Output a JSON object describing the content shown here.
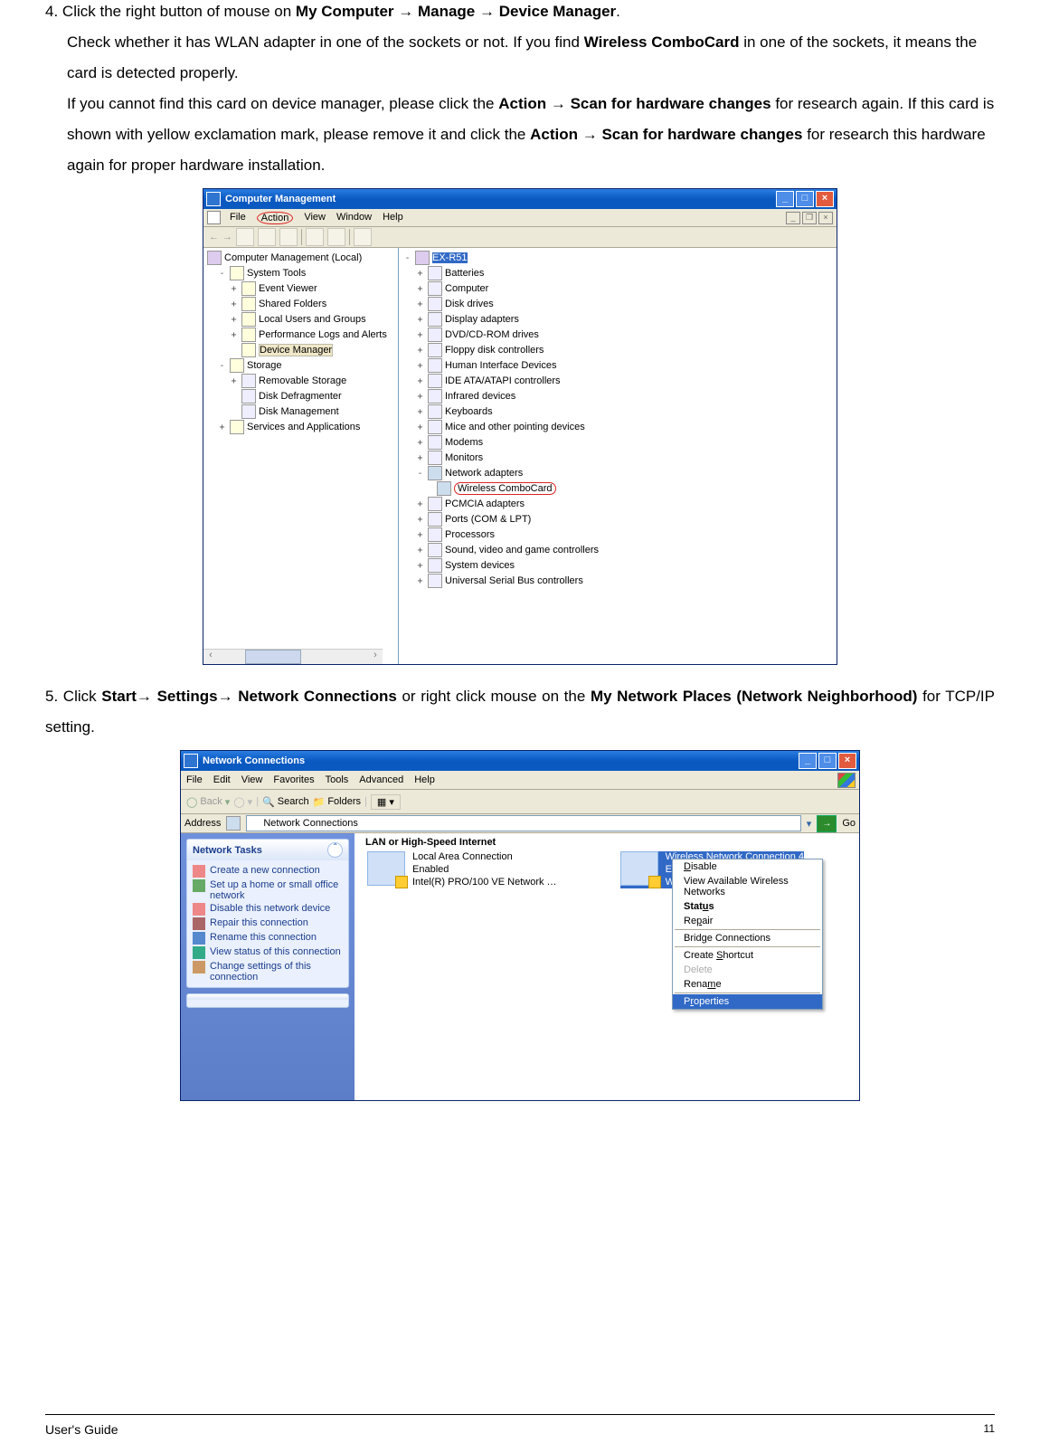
{
  "step4": {
    "num": "4.",
    "l1a": "Click the right button of mouse on ",
    "l1b": "My Computer → Manage → Device Manager",
    "l1c": ".",
    "l2a": "Check whether it has WLAN adapter in one of the sockets or not.  If you find ",
    "l2b": "Wireless ComboCard",
    "l2c": " in one of the sockets, it means the card is detected properly.",
    "l3a": "If you cannot find this card on device manager, please click the ",
    "l3b": "Action → Scan for hardware changes",
    "l3c": " for research again. If this card is shown with yellow exclamation mark, please remove it and click the ",
    "l3d": "Action → Scan for hardware changes",
    "l3e": " for research this hardware again for proper hardware installation."
  },
  "cm": {
    "title": "Computer Management",
    "menu": {
      "file": "File",
      "action": "Action",
      "view": "View",
      "window": "Window",
      "help": "Help"
    },
    "left": {
      "root": "Computer Management (Local)",
      "sys": "System Tools",
      "sys_items": [
        "Event Viewer",
        "Shared Folders",
        "Local Users and Groups",
        "Performance Logs and Alerts",
        "Device Manager"
      ],
      "storage": "Storage",
      "storage_items": [
        "Removable Storage",
        "Disk Defragmenter",
        "Disk Management"
      ],
      "svc": "Services and Applications"
    },
    "right": {
      "root": "EX-R51",
      "items": [
        "Batteries",
        "Computer",
        "Disk drives",
        "Display adapters",
        "DVD/CD-ROM drives",
        "Floppy disk controllers",
        "Human Interface Devices",
        "IDE ATA/ATAPI controllers",
        "Infrared devices",
        "Keyboards",
        "Mice and other pointing devices",
        "Modems",
        "Monitors"
      ],
      "net": "Network adapters",
      "net_child": "Wireless  ComboCard",
      "items2": [
        "PCMCIA adapters",
        "Ports (COM & LPT)",
        "Processors",
        "Sound, video and game controllers",
        "System devices",
        "Universal Serial Bus controllers"
      ]
    }
  },
  "step5": {
    "num": "5.",
    "a": "Click ",
    "b": "Start→ Settings→ Network Connections",
    "c": " or right click mouse on the ",
    "d": "My Network Places (Network Neighborhood)",
    "e": " for TCP/IP setting."
  },
  "nc": {
    "title": "Network Connections",
    "menu": {
      "file": "File",
      "edit": "Edit",
      "view": "View",
      "fav": "Favorites",
      "tools": "Tools",
      "adv": "Advanced",
      "help": "Help"
    },
    "toolbar": {
      "back": "Back",
      "search": "Search",
      "folders": "Folders"
    },
    "addr_label": "Address",
    "addr_value": "Network Connections",
    "go": "Go",
    "tasks_title": "Network Tasks",
    "tasks": [
      "Create a new connection",
      "Set up a home or small office network",
      "Disable this network device",
      "Repair this connection",
      "Rename this connection",
      "View status of this connection",
      "Change settings of this connection"
    ],
    "category": "LAN or High-Speed Internet",
    "conn1": {
      "name": "Local Area Connection",
      "state": "Enabled",
      "dev": "Intel(R) PRO/100 VE Network …"
    },
    "conn2": {
      "name": "Wireless Network Connection 4",
      "state": "Enabled",
      "dev": "Wireless 11a"
    },
    "ctx": [
      "Disable",
      "View Available Wireless Networks",
      "Status",
      "Repair",
      "Bridge Connections",
      "Create Shortcut",
      "Delete",
      "Rename",
      "Properties"
    ]
  },
  "footer": {
    "guide": "User's Guide",
    "page": "11"
  }
}
